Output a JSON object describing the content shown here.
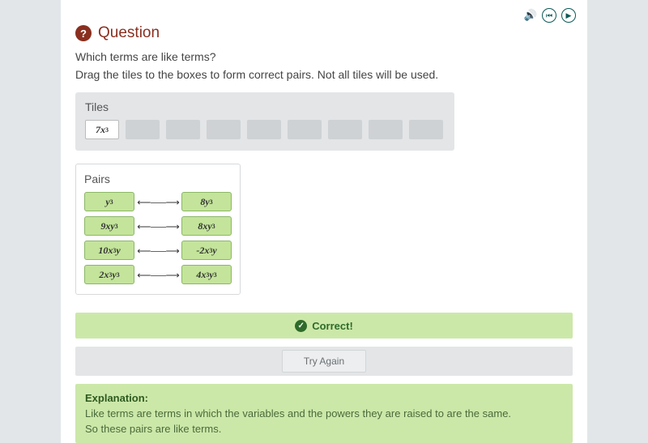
{
  "header": {
    "badge": "?",
    "title": "Question"
  },
  "prompt": {
    "line1": "Which terms are like terms?",
    "line2": "Drag the tiles to the boxes to form correct pairs. Not all tiles will be used."
  },
  "tiles": {
    "title": "Tiles",
    "filled": {
      "base": "7x",
      "exp": "3"
    },
    "empty_count": 8
  },
  "pairs": {
    "title": "Pairs",
    "rows": [
      {
        "left": {
          "base": "y",
          "exp": "3"
        },
        "right": {
          "base": "8y",
          "exp": "3"
        }
      },
      {
        "left": {
          "base": "9xy",
          "exp": "3"
        },
        "right": {
          "base": "8xy",
          "exp": "3"
        }
      },
      {
        "left": {
          "base": "10x",
          "exp": "3",
          "tail": "y"
        },
        "right": {
          "base": "-2x",
          "exp": "3",
          "tail": "y"
        }
      },
      {
        "left": {
          "base": "2x",
          "exp": "3",
          "tail": "y",
          "tailexp": "3"
        },
        "right": {
          "base": "4x",
          "exp": "3",
          "tail": "y",
          "tailexp": "3"
        }
      }
    ],
    "arrow": "⟵⸺⟶"
  },
  "feedback": {
    "correct_label": "Correct!",
    "try_again_label": "Try Again"
  },
  "explanation": {
    "title": "Explanation:",
    "line1": "Like terms are terms in which the variables and the powers they are raised to are the same.",
    "line2": "So these pairs are like terms."
  },
  "icons": {
    "speaker": "🔊",
    "prev": "⏮",
    "play": "▶"
  }
}
